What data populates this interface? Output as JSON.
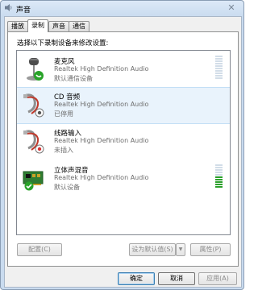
{
  "window": {
    "title": "声音",
    "close_glyph": "✕"
  },
  "tabs": [
    {
      "label": "播放",
      "active": false
    },
    {
      "label": "录制",
      "active": true
    },
    {
      "label": "声音",
      "active": false
    },
    {
      "label": "通信",
      "active": false
    }
  ],
  "instruction": "选择以下录制设备来修改设置:",
  "devices": [
    {
      "name": "麦克风",
      "driver": "Realtek High Definition Audio",
      "status": "默认通信设备",
      "icon": "microphone-icon",
      "badge": "phone-badge-icon",
      "meter_level": 0.0,
      "selected": false
    },
    {
      "name": "CD 音频",
      "driver": "Realtek High Definition Audio",
      "status": "已停用",
      "icon": "cd-audio-cable-icon",
      "badge": "disabled-badge-icon",
      "meter_level": null,
      "selected": true
    },
    {
      "name": "线路输入",
      "driver": "Realtek High Definition Audio",
      "status": "未插入",
      "icon": "line-in-cable-icon",
      "badge": "unplugged-badge-icon",
      "meter_level": null,
      "selected": false
    },
    {
      "name": "立体声混音",
      "driver": "Realtek High Definition Audio",
      "status": "默认设备",
      "icon": "sound-card-icon",
      "badge": "default-check-badge-icon",
      "meter_level": 0.45,
      "selected": false
    }
  ],
  "buttons": {
    "configure": "配置(C)",
    "set_default": "设为默认值(S)",
    "set_default_arrow": "▼",
    "properties": "属性(P)",
    "ok": "确定",
    "cancel": "取消",
    "apply": "应用(A)"
  },
  "colors": {
    "meter_on": "#2ca02c",
    "meter_off": "#d2dde8",
    "selection": "#e9f3fc"
  }
}
